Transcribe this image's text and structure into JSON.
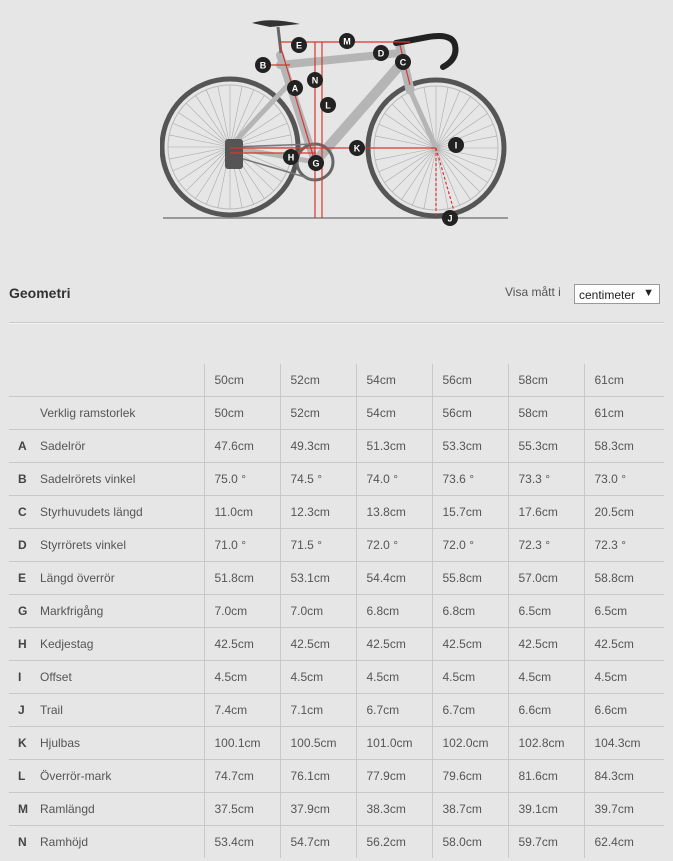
{
  "diagram": {
    "markers": [
      "A",
      "B",
      "C",
      "D",
      "E",
      "G",
      "H",
      "I",
      "J",
      "K",
      "L",
      "M",
      "N"
    ]
  },
  "header": {
    "title": "Geometri",
    "unit_label": "Visa mått i",
    "unit_value": "centimeter"
  },
  "table": {
    "sizes": [
      "50cm",
      "52cm",
      "54cm",
      "56cm",
      "58cm",
      "61cm"
    ],
    "rows": [
      {
        "letter": "",
        "label": "Verklig ramstorlek",
        "values": [
          "50cm",
          "52cm",
          "54cm",
          "56cm",
          "58cm",
          "61cm"
        ]
      },
      {
        "letter": "A",
        "label": "Sadelrör",
        "values": [
          "47.6cm",
          "49.3cm",
          "51.3cm",
          "53.3cm",
          "55.3cm",
          "58.3cm"
        ]
      },
      {
        "letter": "B",
        "label": "Sadelrörets vinkel",
        "values": [
          "75.0 °",
          "74.5 °",
          "74.0 °",
          "73.6 °",
          "73.3 °",
          "73.0 °"
        ]
      },
      {
        "letter": "C",
        "label": "Styrhuvudets längd",
        "values": [
          "11.0cm",
          "12.3cm",
          "13.8cm",
          "15.7cm",
          "17.6cm",
          "20.5cm"
        ]
      },
      {
        "letter": "D",
        "label": "Styrrörets vinkel",
        "values": [
          "71.0 °",
          "71.5 °",
          "72.0 °",
          "72.0 °",
          "72.3 °",
          "72.3 °"
        ]
      },
      {
        "letter": "E",
        "label": "Längd överrör",
        "values": [
          "51.8cm",
          "53.1cm",
          "54.4cm",
          "55.8cm",
          "57.0cm",
          "58.8cm"
        ]
      },
      {
        "letter": "G",
        "label": "Markfrigång",
        "values": [
          "7.0cm",
          "7.0cm",
          "6.8cm",
          "6.8cm",
          "6.5cm",
          "6.5cm"
        ]
      },
      {
        "letter": "H",
        "label": "Kedjestag",
        "values": [
          "42.5cm",
          "42.5cm",
          "42.5cm",
          "42.5cm",
          "42.5cm",
          "42.5cm"
        ]
      },
      {
        "letter": "I",
        "label": "Offset",
        "values": [
          "4.5cm",
          "4.5cm",
          "4.5cm",
          "4.5cm",
          "4.5cm",
          "4.5cm"
        ]
      },
      {
        "letter": "J",
        "label": "Trail",
        "values": [
          "7.4cm",
          "7.1cm",
          "6.7cm",
          "6.7cm",
          "6.6cm",
          "6.6cm"
        ]
      },
      {
        "letter": "K",
        "label": "Hjulbas",
        "values": [
          "100.1cm",
          "100.5cm",
          "101.0cm",
          "102.0cm",
          "102.8cm",
          "104.3cm"
        ]
      },
      {
        "letter": "L",
        "label": "Överrör-mark",
        "values": [
          "74.7cm",
          "76.1cm",
          "77.9cm",
          "79.6cm",
          "81.6cm",
          "84.3cm"
        ]
      },
      {
        "letter": "M",
        "label": "Ramlängd",
        "values": [
          "37.5cm",
          "37.9cm",
          "38.3cm",
          "38.7cm",
          "39.1cm",
          "39.7cm"
        ]
      },
      {
        "letter": "N",
        "label": "Ramhöjd",
        "values": [
          "53.4cm",
          "54.7cm",
          "56.2cm",
          "58.0cm",
          "59.7cm",
          "62.4cm"
        ]
      }
    ]
  }
}
